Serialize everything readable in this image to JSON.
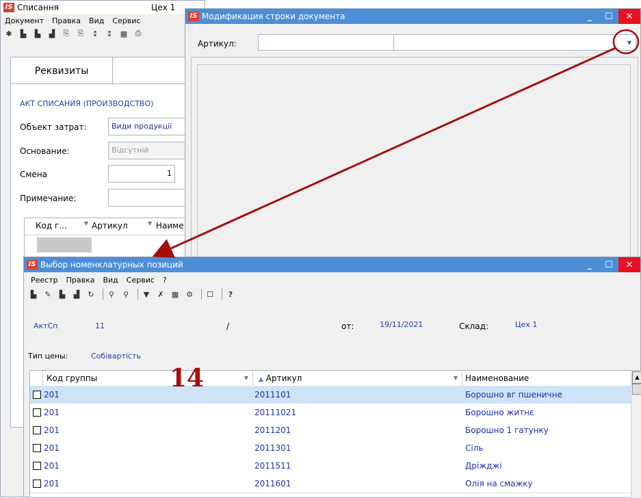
{
  "back_window": {
    "title": "Списання",
    "title_right": "Цех 1",
    "menu": [
      "Документ",
      "Правка",
      "Вид",
      "Сервис"
    ],
    "tab": "Реквизиты",
    "doc_type": "АКТ СПИСАНИЯ (ПРОИЗВОДСТВО)",
    "fields": {
      "cost_object_label": "Объект затрат:",
      "cost_object_value": "Види продукції",
      "basis_label": "Основание:",
      "basis_value": "Відсутній",
      "shift_label": "Смена",
      "shift_value": "1",
      "note_label": "Примечание:"
    },
    "grid_headers": [
      "Код г...",
      "Артикул",
      "Наиме"
    ]
  },
  "modify_window": {
    "title": "Модификация строки документа",
    "article_label": "Артикул:",
    "article_value": ""
  },
  "select_window": {
    "title": "Выбор номенклатурных позиций",
    "menu": [
      "Реестр",
      "Правка",
      "Вид",
      "Сервис",
      "?"
    ],
    "info": {
      "doc_label": "АктСп",
      "doc_number": "11",
      "slash": "/",
      "date_label": "от:",
      "date_value": "19/11/2021",
      "warehouse_label": "Склад:",
      "warehouse_value": "Цех 1",
      "price_type_label": "Тип цены:",
      "price_type_value": "Собівартість"
    },
    "columns": [
      "Код группы",
      "Артикул",
      "Наименование"
    ],
    "rows": [
      {
        "group": "201",
        "article": "2011101",
        "name": "Борошно вг пшеничне"
      },
      {
        "group": "201",
        "article": "20111021",
        "name": "Борошно житнє"
      },
      {
        "group": "201",
        "article": "2011201",
        "name": "Борошно 1 гатунку"
      },
      {
        "group": "201",
        "article": "2011301",
        "name": "Сіль"
      },
      {
        "group": "201",
        "article": "2011511",
        "name": "Дріжджі"
      },
      {
        "group": "201",
        "article": "2011601",
        "name": "Олія на смажку"
      }
    ]
  },
  "annotation": {
    "step_number": "14",
    "color": "#a50d0d"
  },
  "colors": {
    "title_active": "#4d8fd6",
    "selection": "#cde3f7",
    "link_text": "#1a2fb0",
    "close_button": "#e81123"
  }
}
